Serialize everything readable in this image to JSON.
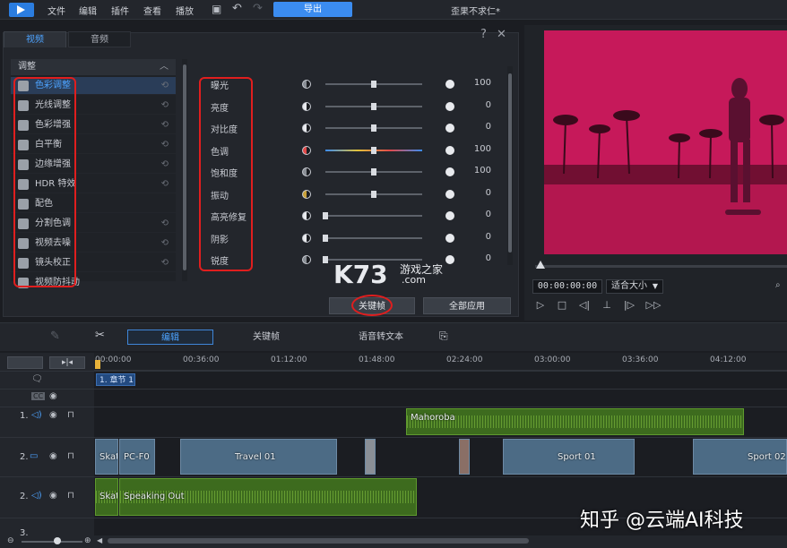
{
  "app": {
    "menu": [
      "文件",
      "编辑",
      "插件",
      "查看",
      "播放"
    ],
    "export_label": "导出",
    "project_title": "歪果不求仁*"
  },
  "panel": {
    "tabs": [
      "视频",
      "音频"
    ],
    "help": "?",
    "close": "✕",
    "adjust_header": "调整",
    "adjust_items": [
      {
        "label": "色彩调整",
        "selected": true
      },
      {
        "label": "光线调整",
        "selected": false
      },
      {
        "label": "色彩增强",
        "selected": false
      },
      {
        "label": "白平衡",
        "selected": false
      },
      {
        "label": "边缘增强",
        "selected": false
      },
      {
        "label": "HDR 特效",
        "selected": false
      },
      {
        "label": "配色",
        "selected": false
      },
      {
        "label": "分割色调",
        "selected": false
      },
      {
        "label": "视频去噪",
        "selected": false
      },
      {
        "label": "镜头校正",
        "selected": false
      },
      {
        "label": "视频防抖动",
        "selected": false
      }
    ],
    "params": [
      {
        "label": "曝光",
        "value": "100",
        "level": 0.5
      },
      {
        "label": "亮度",
        "value": "0",
        "level": 0.5
      },
      {
        "label": "对比度",
        "value": "0",
        "level": 0.5
      },
      {
        "label": "色调",
        "value": "100",
        "level": 0.5
      },
      {
        "label": "饱和度",
        "value": "100",
        "level": 0.5
      },
      {
        "label": "振动",
        "value": "0",
        "level": 0.5
      },
      {
        "label": "高亮修复",
        "value": "0",
        "level": 0.0
      },
      {
        "label": "阴影",
        "value": "0",
        "level": 0.0
      },
      {
        "label": "锐度",
        "value": "0",
        "level": 0.0
      }
    ],
    "keyframe_btn": "关键帧",
    "apply_all_btn": "全部应用"
  },
  "watermark": {
    "k73": "K73",
    "site": "游戏之家",
    "com": ".com"
  },
  "preview": {
    "timecode": "00:00:00:00",
    "fit": "适合大小",
    "fit_arrow": "▼"
  },
  "toolbar": {
    "edit": "编辑",
    "keyframe": "关键帧",
    "speech_to_text": "语音转文本"
  },
  "timeline": {
    "ruler": [
      "00:00:00",
      "00:36:00",
      "01:12:00",
      "01:48:00",
      "02:24:00",
      "03:00:00",
      "03:36:00",
      "04:12:00"
    ],
    "chapter": "1. 章节 1",
    "track_numbers": [
      "1.",
      "2.",
      "2.",
      "3."
    ],
    "clips": {
      "audio1": "Mahoroba",
      "v1": "Skat",
      "v2": "PC-F0",
      "v3": "Travel 01",
      "v4": "Sport 01",
      "v5": "Sport 02",
      "a2_1": "Skat",
      "a2_2": "Speaking Out"
    }
  },
  "colors": {
    "accent": "#3b8cf0",
    "preview_tint": "#c6195a",
    "highlight_red": "#e01e1e"
  },
  "bottom_watermark": "知乎 @云端AI科技"
}
